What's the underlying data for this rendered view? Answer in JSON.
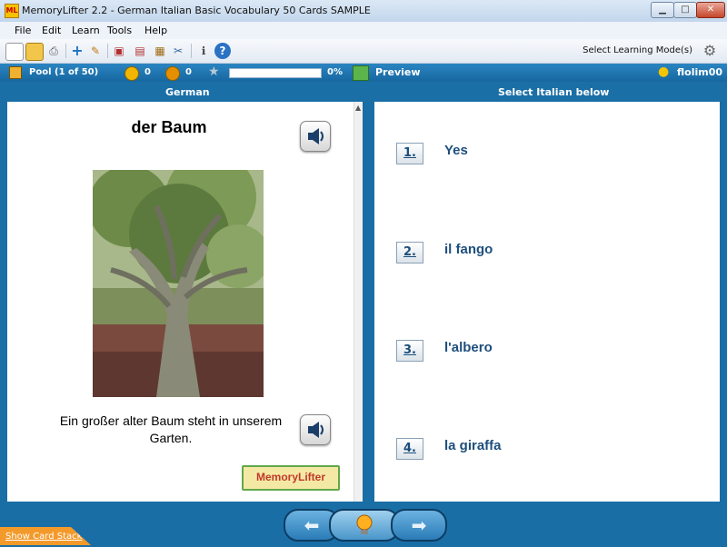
{
  "window": {
    "title": "MemoryLifter 2.2 - German Italian Basic Vocabulary 50 Cards SAMPLE",
    "app_icon_text": "ML"
  },
  "menu": [
    "File",
    "Edit",
    "Learn",
    "Tools",
    "Help"
  ],
  "toolbar": {
    "mode_label": "Select Learning Mode(s)"
  },
  "status": {
    "pool_label": "Pool",
    "pool_count": "(1 of 50)",
    "happy_count": "0",
    "sad_count": "0",
    "progress_fraction": 0,
    "progress_percent": "0%",
    "preview_label": "Preview",
    "username": "flolim00"
  },
  "columns": {
    "left_header": "German",
    "right_header": "Select Italian below"
  },
  "card": {
    "word": "der Baum",
    "sentence": "Ein großer alter Baum steht in unserem Garten.",
    "logo_text": "MemoryLifter"
  },
  "choices": [
    {
      "num": "1.",
      "text": "Yes"
    },
    {
      "num": "2.",
      "text": "il fango"
    },
    {
      "num": "3.",
      "text": "l'albero"
    },
    {
      "num": "4.",
      "text": "la giraffa"
    }
  ],
  "bottom": {
    "show_stack_label": "Show Card Stack"
  },
  "colors": {
    "accent": "#1a6ea6",
    "choice_text": "#1e4f7c",
    "progress_fill": "#5fb35a"
  }
}
